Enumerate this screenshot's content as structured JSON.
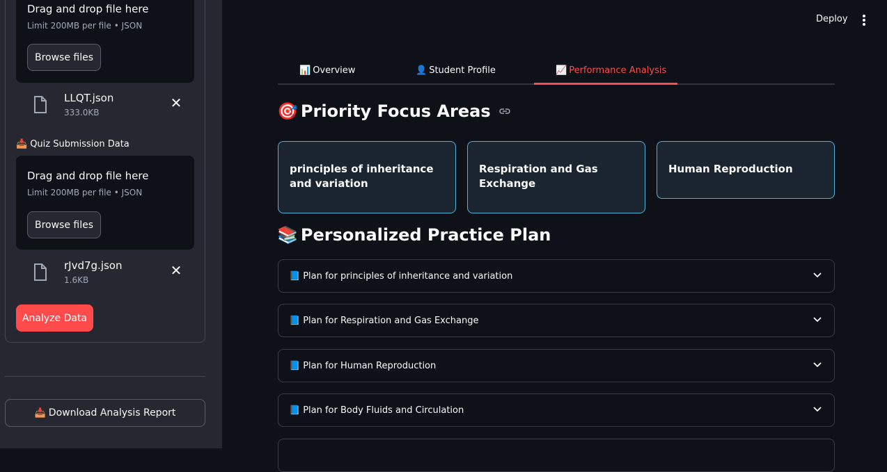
{
  "sidebar": {
    "uploads": [
      {
        "dz_title": "Drag and drop file here",
        "dz_limit": "Limit 200MB per file • JSON",
        "browse_label": "Browse files",
        "file_name": "LLQT.json",
        "file_size": "333.0KB"
      },
      {
        "dz_title": "Drag and drop file here",
        "dz_limit": "Limit 200MB per file • JSON",
        "browse_label": "Browse files",
        "file_name": "rJvd7g.json",
        "file_size": "1.6KB"
      }
    ],
    "quiz_label": "Quiz Submission Data",
    "quiz_emoji": "📥",
    "analyze_label": "Analyze Data",
    "download_label": "Download Analysis Report",
    "download_emoji": "📥"
  },
  "header": {
    "deploy_label": "Deploy"
  },
  "tabs": [
    {
      "emoji": "📊",
      "label": "Overview"
    },
    {
      "emoji": "👤",
      "label": "Student Profile"
    },
    {
      "emoji": "📈",
      "label": "Performance Analysis"
    }
  ],
  "focus": {
    "emoji": "🎯",
    "title": "Priority Focus Areas",
    "cards": [
      "principles of inheritance and variation",
      "Respiration and Gas Exchange",
      "Human Reproduction"
    ]
  },
  "plan": {
    "emoji": "📚",
    "title": "Personalized Practice Plan",
    "items_emoji": "📘",
    "items": [
      "Plan for principles of inheritance and variation",
      "Plan for Respiration and Gas Exchange",
      "Plan for Human Reproduction",
      "Plan for Body Fluids and Circulation"
    ]
  },
  "colors": {
    "accent": "#ff4b4b",
    "card_border": "#4fb3d9",
    "background": "#0e1117",
    "sidebar": "#262730"
  }
}
